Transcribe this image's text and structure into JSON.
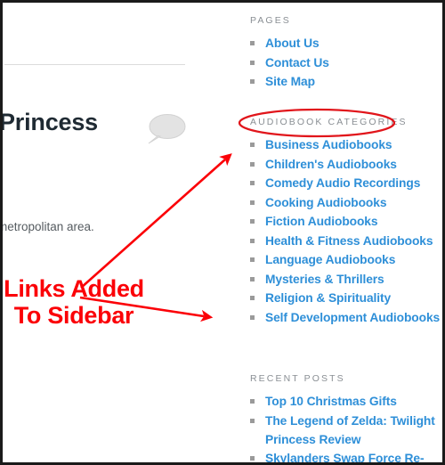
{
  "colors": {
    "link": "#2e8fd8",
    "widget_title": "#8a8f94",
    "annotation_red": "#fb0007",
    "heading": "#1f2a33",
    "body_text": "#555b60",
    "bullet": "#9a9a9a",
    "frame": "#1a1a1a"
  },
  "content": {
    "post_title": "Princess",
    "body_text": "metropolitan area.",
    "comment_icon": "speech-bubble-icon"
  },
  "sidebar": {
    "widgets": [
      {
        "title": "PAGES",
        "items": [
          {
            "label": "About Us"
          },
          {
            "label": "Contact Us"
          },
          {
            "label": "Site Map"
          }
        ]
      },
      {
        "title": "AUDIOBOOK CATEGORIES",
        "items": [
          {
            "label": "Business Audiobooks"
          },
          {
            "label": "Children's Audiobooks"
          },
          {
            "label": "Comedy Audio Recordings"
          },
          {
            "label": "Cooking Audiobooks"
          },
          {
            "label": "Fiction Audiobooks"
          },
          {
            "label": "Health & Fitness Audiobooks"
          },
          {
            "label": "Language Audiobooks"
          },
          {
            "label": "Mysteries & Thrillers"
          },
          {
            "label": "Religion & Spirituality"
          },
          {
            "label": "Self Development Audiobooks"
          }
        ]
      },
      {
        "title": "RECENT POSTS",
        "items": [
          {
            "label": "Top 10 Christmas Gifts"
          },
          {
            "label": "The Legend of Zelda: Twilight Princess Review"
          },
          {
            "label": "Skylanders Swap Force Re-"
          }
        ]
      }
    ]
  },
  "annotations": {
    "callout_text": "Links Added To Sidebar",
    "ellipse_target": "AUDIOBOOK CATEGORIES",
    "arrows": [
      {
        "name": "arrow-to-categories-top"
      },
      {
        "name": "arrow-to-categories-bottom"
      }
    ]
  }
}
